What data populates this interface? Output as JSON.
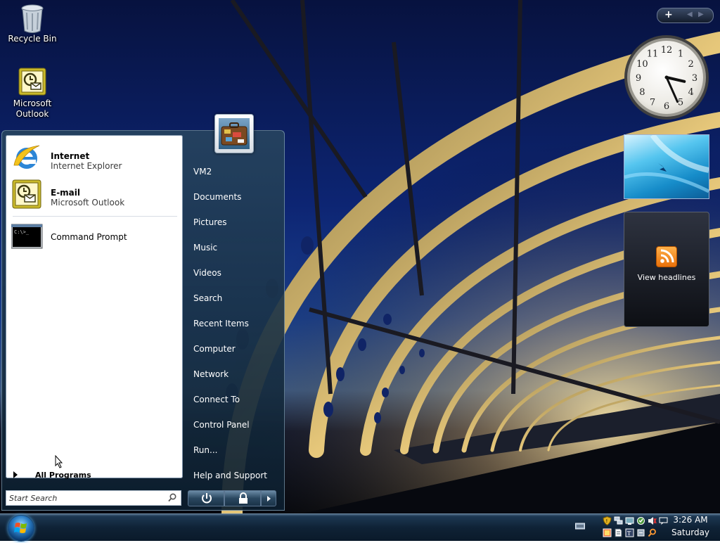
{
  "desktop": {
    "icons": [
      {
        "label": "Recycle Bin",
        "icon": "recycle-bin-icon"
      },
      {
        "label": "Microsoft\nOutlook",
        "line1": "Microsoft",
        "line2": "Outlook",
        "icon": "outlook-icon"
      }
    ]
  },
  "gadgets": {
    "toolbar_add": "+",
    "clock": {
      "hour": 3,
      "minute": 26,
      "numbers": [
        "12",
        "1",
        "2",
        "3",
        "4",
        "5",
        "6",
        "7",
        "8",
        "9",
        "10",
        "11"
      ]
    },
    "feeds": {
      "label": "View headlines",
      "icon": "rss-feed-icon"
    }
  },
  "start_menu": {
    "pinned": [
      {
        "title": "Internet",
        "subtitle": "Internet Explorer",
        "icon": "internet-explorer-icon"
      },
      {
        "title": "E-mail",
        "subtitle": "Microsoft Outlook",
        "icon": "outlook-icon"
      }
    ],
    "recent": [
      {
        "title": "Command Prompt",
        "icon": "command-prompt-icon"
      }
    ],
    "all_programs": "All Programs",
    "search_placeholder": "Start Search",
    "right_links": [
      "VM2",
      "Documents",
      "Pictures",
      "Music",
      "Videos",
      "Search",
      "Recent Items",
      "Computer",
      "Network",
      "Connect To",
      "Control Panel",
      "Run...",
      "Help and Support"
    ],
    "power": {
      "power_icon": "power-icon",
      "lock_icon": "lock-icon",
      "arrow_icon": "triangle-right-icon"
    }
  },
  "taskbar": {
    "time": "3:26 AM",
    "day": "Saturday"
  }
}
